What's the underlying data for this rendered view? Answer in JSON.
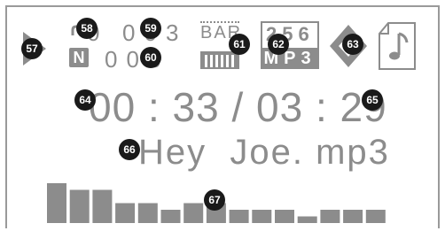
{
  "display": {
    "repeat_digit": "0",
    "counter_top": [
      "0",
      "0",
      "3"
    ],
    "counter_bottom": [
      "0",
      "0",
      "6"
    ],
    "norm_badge": "N",
    "bar_label": "BAR",
    "bitrate_digits": "256",
    "format_label": "MP3",
    "time_elapsed": "00 : 33",
    "time_separator": "/",
    "time_total": "03 : 29",
    "track_name": "Hey  Joe. mp3",
    "equalizer_levels": [
      6,
      5,
      5,
      3,
      3,
      2,
      3,
      3,
      2,
      2,
      2,
      1,
      2,
      2,
      2
    ]
  },
  "callouts": [
    "57",
    "58",
    "59",
    "60",
    "61",
    "62",
    "63",
    "64",
    "65",
    "66",
    "67"
  ],
  "colors": {
    "lcd": "#8c8c8c",
    "callout": "#1a1a1a",
    "background": "#ffffff"
  }
}
